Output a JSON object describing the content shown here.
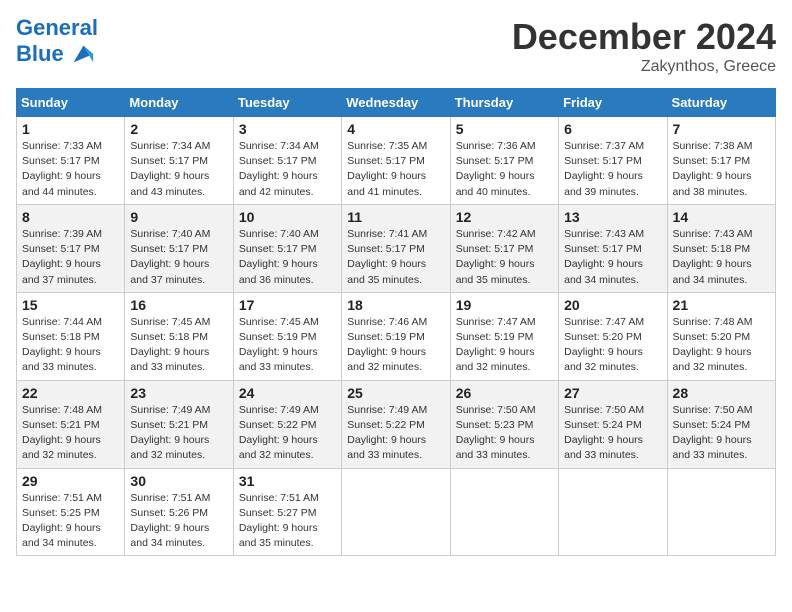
{
  "header": {
    "logo_line1": "General",
    "logo_line2": "Blue",
    "month_title": "December 2024",
    "location": "Zakynthos, Greece"
  },
  "weekdays": [
    "Sunday",
    "Monday",
    "Tuesday",
    "Wednesday",
    "Thursday",
    "Friday",
    "Saturday"
  ],
  "weeks": [
    [
      {
        "day": "1",
        "sunrise": "Sunrise: 7:33 AM",
        "sunset": "Sunset: 5:17 PM",
        "daylight": "Daylight: 9 hours and 44 minutes."
      },
      {
        "day": "2",
        "sunrise": "Sunrise: 7:34 AM",
        "sunset": "Sunset: 5:17 PM",
        "daylight": "Daylight: 9 hours and 43 minutes."
      },
      {
        "day": "3",
        "sunrise": "Sunrise: 7:34 AM",
        "sunset": "Sunset: 5:17 PM",
        "daylight": "Daylight: 9 hours and 42 minutes."
      },
      {
        "day": "4",
        "sunrise": "Sunrise: 7:35 AM",
        "sunset": "Sunset: 5:17 PM",
        "daylight": "Daylight: 9 hours and 41 minutes."
      },
      {
        "day": "5",
        "sunrise": "Sunrise: 7:36 AM",
        "sunset": "Sunset: 5:17 PM",
        "daylight": "Daylight: 9 hours and 40 minutes."
      },
      {
        "day": "6",
        "sunrise": "Sunrise: 7:37 AM",
        "sunset": "Sunset: 5:17 PM",
        "daylight": "Daylight: 9 hours and 39 minutes."
      },
      {
        "day": "7",
        "sunrise": "Sunrise: 7:38 AM",
        "sunset": "Sunset: 5:17 PM",
        "daylight": "Daylight: 9 hours and 38 minutes."
      }
    ],
    [
      {
        "day": "8",
        "sunrise": "Sunrise: 7:39 AM",
        "sunset": "Sunset: 5:17 PM",
        "daylight": "Daylight: 9 hours and 37 minutes."
      },
      {
        "day": "9",
        "sunrise": "Sunrise: 7:40 AM",
        "sunset": "Sunset: 5:17 PM",
        "daylight": "Daylight: 9 hours and 37 minutes."
      },
      {
        "day": "10",
        "sunrise": "Sunrise: 7:40 AM",
        "sunset": "Sunset: 5:17 PM",
        "daylight": "Daylight: 9 hours and 36 minutes."
      },
      {
        "day": "11",
        "sunrise": "Sunrise: 7:41 AM",
        "sunset": "Sunset: 5:17 PM",
        "daylight": "Daylight: 9 hours and 35 minutes."
      },
      {
        "day": "12",
        "sunrise": "Sunrise: 7:42 AM",
        "sunset": "Sunset: 5:17 PM",
        "daylight": "Daylight: 9 hours and 35 minutes."
      },
      {
        "day": "13",
        "sunrise": "Sunrise: 7:43 AM",
        "sunset": "Sunset: 5:17 PM",
        "daylight": "Daylight: 9 hours and 34 minutes."
      },
      {
        "day": "14",
        "sunrise": "Sunrise: 7:43 AM",
        "sunset": "Sunset: 5:18 PM",
        "daylight": "Daylight: 9 hours and 34 minutes."
      }
    ],
    [
      {
        "day": "15",
        "sunrise": "Sunrise: 7:44 AM",
        "sunset": "Sunset: 5:18 PM",
        "daylight": "Daylight: 9 hours and 33 minutes."
      },
      {
        "day": "16",
        "sunrise": "Sunrise: 7:45 AM",
        "sunset": "Sunset: 5:18 PM",
        "daylight": "Daylight: 9 hours and 33 minutes."
      },
      {
        "day": "17",
        "sunrise": "Sunrise: 7:45 AM",
        "sunset": "Sunset: 5:19 PM",
        "daylight": "Daylight: 9 hours and 33 minutes."
      },
      {
        "day": "18",
        "sunrise": "Sunrise: 7:46 AM",
        "sunset": "Sunset: 5:19 PM",
        "daylight": "Daylight: 9 hours and 32 minutes."
      },
      {
        "day": "19",
        "sunrise": "Sunrise: 7:47 AM",
        "sunset": "Sunset: 5:19 PM",
        "daylight": "Daylight: 9 hours and 32 minutes."
      },
      {
        "day": "20",
        "sunrise": "Sunrise: 7:47 AM",
        "sunset": "Sunset: 5:20 PM",
        "daylight": "Daylight: 9 hours and 32 minutes."
      },
      {
        "day": "21",
        "sunrise": "Sunrise: 7:48 AM",
        "sunset": "Sunset: 5:20 PM",
        "daylight": "Daylight: 9 hours and 32 minutes."
      }
    ],
    [
      {
        "day": "22",
        "sunrise": "Sunrise: 7:48 AM",
        "sunset": "Sunset: 5:21 PM",
        "daylight": "Daylight: 9 hours and 32 minutes."
      },
      {
        "day": "23",
        "sunrise": "Sunrise: 7:49 AM",
        "sunset": "Sunset: 5:21 PM",
        "daylight": "Daylight: 9 hours and 32 minutes."
      },
      {
        "day": "24",
        "sunrise": "Sunrise: 7:49 AM",
        "sunset": "Sunset: 5:22 PM",
        "daylight": "Daylight: 9 hours and 32 minutes."
      },
      {
        "day": "25",
        "sunrise": "Sunrise: 7:49 AM",
        "sunset": "Sunset: 5:22 PM",
        "daylight": "Daylight: 9 hours and 33 minutes."
      },
      {
        "day": "26",
        "sunrise": "Sunrise: 7:50 AM",
        "sunset": "Sunset: 5:23 PM",
        "daylight": "Daylight: 9 hours and 33 minutes."
      },
      {
        "day": "27",
        "sunrise": "Sunrise: 7:50 AM",
        "sunset": "Sunset: 5:24 PM",
        "daylight": "Daylight: 9 hours and 33 minutes."
      },
      {
        "day": "28",
        "sunrise": "Sunrise: 7:50 AM",
        "sunset": "Sunset: 5:24 PM",
        "daylight": "Daylight: 9 hours and 33 minutes."
      }
    ],
    [
      {
        "day": "29",
        "sunrise": "Sunrise: 7:51 AM",
        "sunset": "Sunset: 5:25 PM",
        "daylight": "Daylight: 9 hours and 34 minutes."
      },
      {
        "day": "30",
        "sunrise": "Sunrise: 7:51 AM",
        "sunset": "Sunset: 5:26 PM",
        "daylight": "Daylight: 9 hours and 34 minutes."
      },
      {
        "day": "31",
        "sunrise": "Sunrise: 7:51 AM",
        "sunset": "Sunset: 5:27 PM",
        "daylight": "Daylight: 9 hours and 35 minutes."
      },
      null,
      null,
      null,
      null
    ]
  ]
}
